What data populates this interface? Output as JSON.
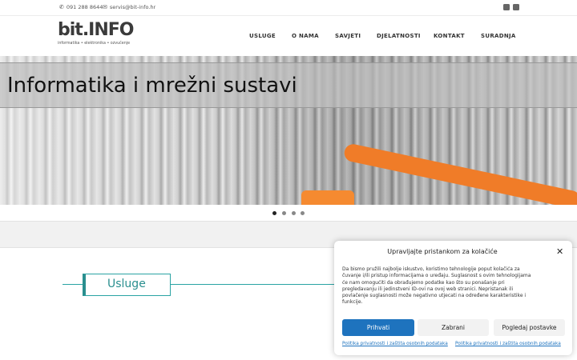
{
  "topbar": {
    "phone": "091 288 8644",
    "email": "servis@bit-info.hr",
    "icons": [
      "phone-icon",
      "envelope-icon",
      "instagram-icon",
      "facebook-icon"
    ]
  },
  "logo": {
    "brand_main": "bit",
    "brand_suffix": ".INFO",
    "tagline": "informatika • elektronika • ozvučenje"
  },
  "nav": {
    "items": [
      "USLUGE",
      "O NAMA",
      "SAVJETI",
      "DJELATNOSTI",
      "KONTAKT",
      "SURADNJA"
    ]
  },
  "hero": {
    "caption": "Informatika i mrežni sustavi",
    "slides": 4,
    "active_slide": 1
  },
  "section": {
    "title": "Usluge"
  },
  "cookie": {
    "title": "Upravljajte pristankom za kolačiće",
    "text": "Da bismo pružili najbolje iskustvo, koristimo tehnologije poput kolačića za čuvanje i/ili pristup informacijama o uređaju. Suglasnost s ovim tehnologijama će nam omogućiti da obrađujemo podatke kao što su ponašanje pri pregledavanju ili jedinstveni ID-ovi na ovoj web stranici. Nepristanak ili povlačenje suglasnosti može negativno utjecati na određene karakteristike i funkcije.",
    "accept_label": "Prihvati",
    "deny_label": "Zabrani",
    "prefs_label": "Pogledaj postavke",
    "link1": "Politika privatnosti i zaštita osobnih podataka",
    "link2": "Politika privatnosti i zaštita osobnih podataka",
    "close_symbol": "✕",
    "accent_color": "#1e73be"
  },
  "colors": {
    "teal": "#2aa3a3",
    "cable_orange": "#f07c28"
  }
}
